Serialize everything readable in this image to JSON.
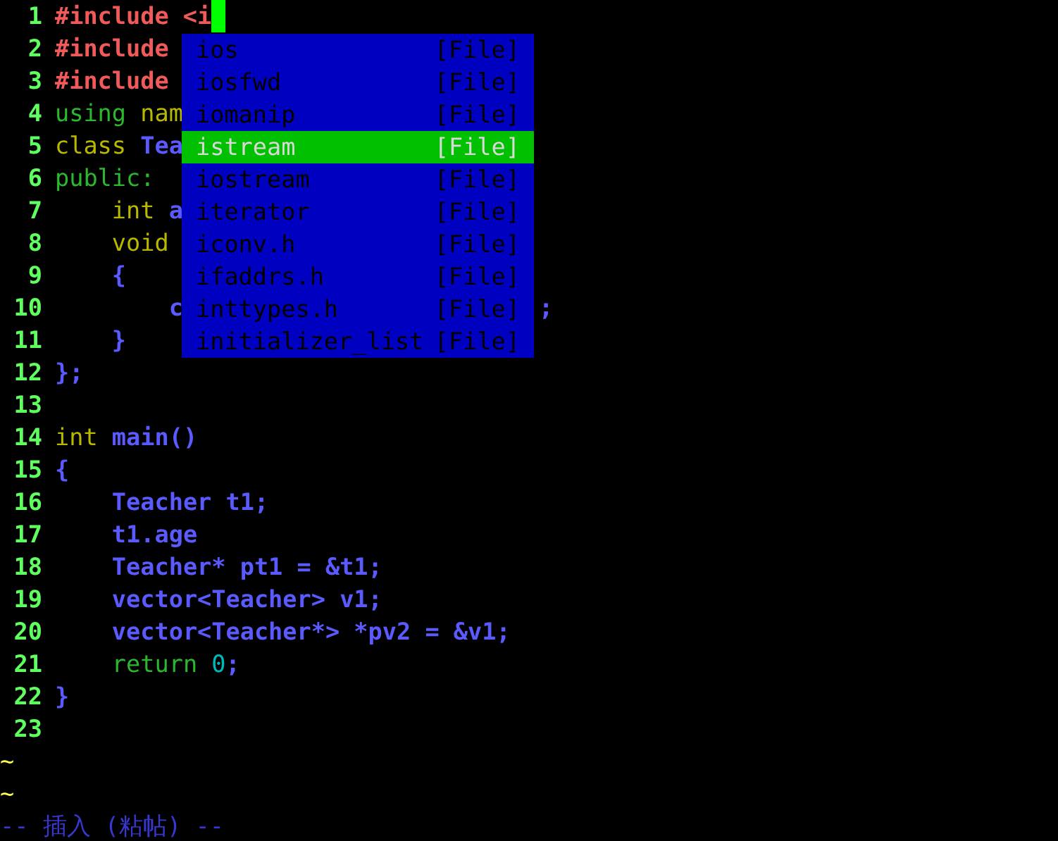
{
  "editor": {
    "lines": [
      {
        "number": "1",
        "tokens": [
          {
            "kind": "preproc",
            "text": "#include <i"
          }
        ],
        "cursor": true
      },
      {
        "number": "2",
        "tokens": [
          {
            "kind": "preproc",
            "text": "#include"
          }
        ],
        "cursor": false
      },
      {
        "number": "3",
        "tokens": [
          {
            "kind": "preproc",
            "text": "#include"
          }
        ],
        "cursor": false
      },
      {
        "number": "4",
        "tokens": [
          {
            "kind": "statement",
            "text": "using"
          },
          {
            "kind": "type",
            "text": " nam"
          }
        ],
        "cursor": false
      },
      {
        "number": "5",
        "tokens": [
          {
            "kind": "type",
            "text": "class"
          },
          {
            "kind": "identifier",
            "text": " Tea"
          }
        ],
        "cursor": false
      },
      {
        "number": "6",
        "tokens": [
          {
            "kind": "statement",
            "text": "public:"
          }
        ],
        "cursor": false
      },
      {
        "number": "7",
        "tokens": [
          {
            "kind": "type",
            "text": "    int"
          },
          {
            "kind": "identifier",
            "text": " a"
          }
        ],
        "cursor": false
      },
      {
        "number": "8",
        "tokens": [
          {
            "kind": "type",
            "text": "    void"
          }
        ],
        "cursor": false
      },
      {
        "number": "9",
        "tokens": [
          {
            "kind": "identifier",
            "text": "    {"
          }
        ],
        "cursor": false
      },
      {
        "number": "10",
        "tokens": [
          {
            "kind": "identifier",
            "text": "        c"
          },
          {
            "kind": "identifier",
            "text": "                         ;"
          }
        ],
        "cursor": false
      },
      {
        "number": "11",
        "tokens": [
          {
            "kind": "identifier",
            "text": "    }"
          }
        ],
        "cursor": false
      },
      {
        "number": "12",
        "tokens": [
          {
            "kind": "identifier",
            "text": "};"
          }
        ],
        "cursor": false
      },
      {
        "number": "13",
        "cursor": false
      },
      {
        "number": "14",
        "tokens": [
          {
            "kind": "type",
            "text": "int"
          },
          {
            "kind": "identifier",
            "text": " main()"
          }
        ],
        "cursor": false
      },
      {
        "number": "15",
        "tokens": [
          {
            "kind": "identifier",
            "text": "{"
          }
        ],
        "cursor": false
      },
      {
        "number": "16",
        "tokens": [
          {
            "kind": "identifier",
            "text": "    Teacher t1;"
          }
        ],
        "cursor": false
      },
      {
        "number": "17",
        "tokens": [
          {
            "kind": "identifier",
            "text": "    t1.age"
          }
        ],
        "cursor": false
      },
      {
        "number": "18",
        "tokens": [
          {
            "kind": "identifier",
            "text": "    Teacher* pt1 = &t1;"
          }
        ],
        "cursor": false
      },
      {
        "number": "19",
        "tokens": [
          {
            "kind": "identifier",
            "text": "    vector<Teacher> v1;"
          }
        ],
        "cursor": false
      },
      {
        "number": "20",
        "tokens": [
          {
            "kind": "identifier",
            "text": "    vector<Teacher*> *pv2 = &v1;"
          }
        ],
        "cursor": false
      },
      {
        "number": "21",
        "tokens": [
          {
            "kind": "statement",
            "text": "    return"
          },
          {
            "kind": "number",
            "text": " 0"
          },
          {
            "kind": "identifier",
            "text": ";"
          }
        ],
        "cursor": false
      },
      {
        "number": "22",
        "tokens": [
          {
            "kind": "identifier",
            "text": "}"
          }
        ],
        "cursor": false
      },
      {
        "number": "23",
        "cursor": false
      }
    ],
    "empty_markers": [
      "~",
      "~"
    ]
  },
  "completion_menu": {
    "items": [
      {
        "label": "ios",
        "kind_label": "[File]",
        "selected": false
      },
      {
        "label": "iosfwd",
        "kind_label": "[File]",
        "selected": false
      },
      {
        "label": "iomanip",
        "kind_label": "[File]",
        "selected": false
      },
      {
        "label": "istream",
        "kind_label": "[File]",
        "selected": true
      },
      {
        "label": "iostream",
        "kind_label": "[File]",
        "selected": false
      },
      {
        "label": "iterator",
        "kind_label": "[File]",
        "selected": false
      },
      {
        "label": "iconv.h",
        "kind_label": "[File]",
        "selected": false
      },
      {
        "label": "ifaddrs.h",
        "kind_label": "[File]",
        "selected": false
      },
      {
        "label": "inttypes.h",
        "kind_label": "[File]",
        "selected": false
      },
      {
        "label": "initializer_list",
        "kind_label": "[File]",
        "selected": false
      }
    ]
  },
  "status_line": "-- 插入 (粘帖) --"
}
